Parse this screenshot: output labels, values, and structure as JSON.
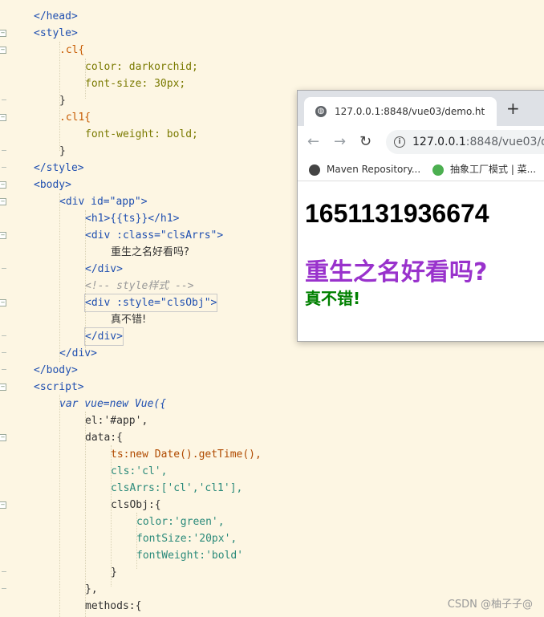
{
  "editor": {
    "lines": [
      "</head>",
      "<style>",
      ".cl{",
      "color: darkorchid;",
      "font-size: 30px;",
      "}",
      ".cl1{",
      "font-weight: bold;",
      "}",
      "</style>",
      "<body>",
      "<div id=\"app\">",
      "<h1>{{ts}}</h1>",
      "<div :class=\"clsArrs\">",
      "重生之名好看吗?",
      "</div>",
      "<!-- style样式 -->",
      "<div :style=\"clsObj\">",
      "真不错!",
      "</div>",
      "</div>",
      "</body>",
      "<script>",
      "var vue=new Vue({",
      "el:'#app',",
      "data:{",
      "ts:new Date().getTime(),",
      "cls:'cl',",
      "clsArrs:['cl','cl1'],",
      "clsObj:{",
      "color:'green',",
      "fontSize:'20px',",
      "fontWeight:'bold'",
      "}",
      "},",
      "methods:{"
    ]
  },
  "browser": {
    "tab_title": "127.0.0.1:8848/vue03/demo.ht",
    "new_tab": "+",
    "url_host": "127.0.0.1",
    "url_rest": ":8848/vue03/de",
    "bookmarks": [
      {
        "label": "Maven Repository...",
        "icon": "globe-icon"
      },
      {
        "label": "抽象工厂模式 | 菜...",
        "icon": "runoob-icon"
      }
    ],
    "page": {
      "timestamp": "1651131936674",
      "cls_text": "重生之名好看吗?",
      "obj_text": "真不错!"
    }
  },
  "watermark": "CSDN @柚子子@",
  "colors": {
    "editor_bg": "#fdf6e3",
    "tag": "#1f4fb0",
    "attr": "#c2185b",
    "string": "#2a8a7a",
    "orchid": "darkorchid",
    "green": "green"
  }
}
